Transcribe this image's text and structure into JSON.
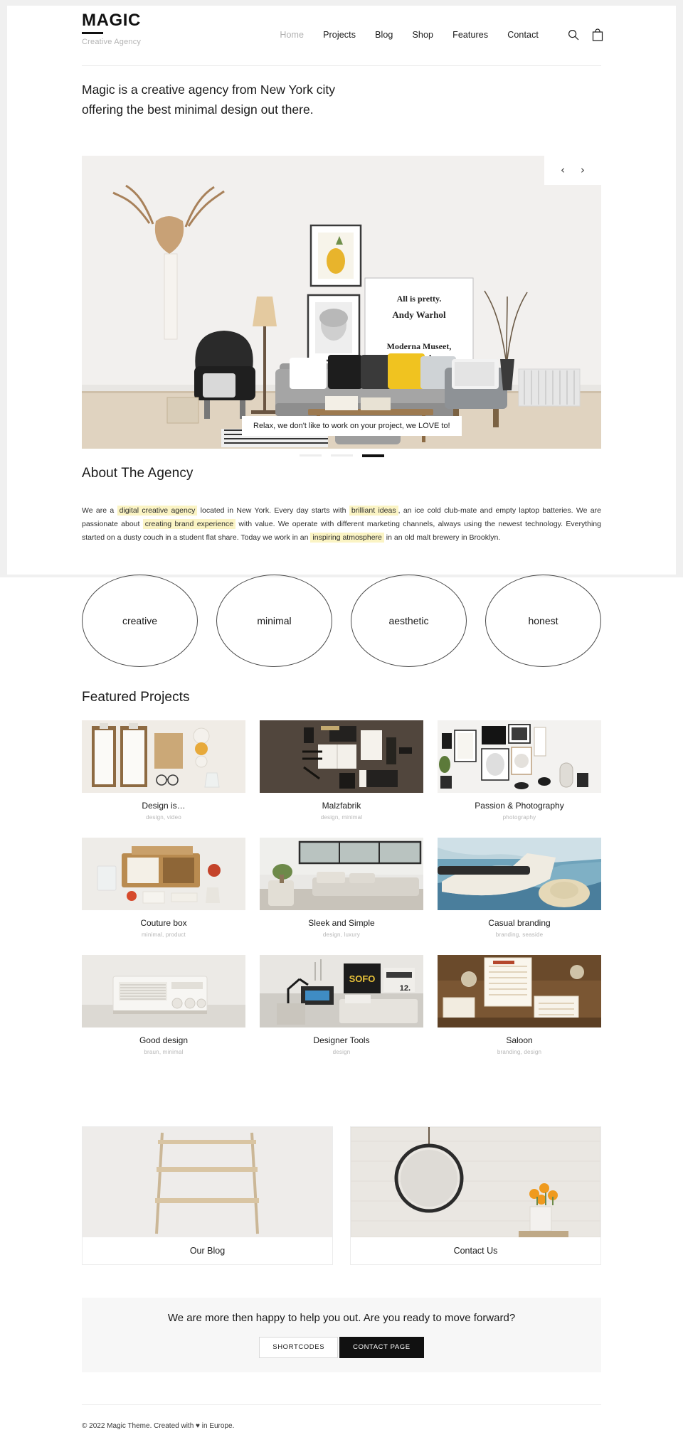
{
  "brand": {
    "name": "MAGIC",
    "tagline": "Creative Agency"
  },
  "nav": {
    "items": [
      {
        "label": "Home",
        "active": true
      },
      {
        "label": "Projects",
        "active": false
      },
      {
        "label": "Blog",
        "active": false
      },
      {
        "label": "Shop",
        "active": false
      },
      {
        "label": "Features",
        "active": false
      },
      {
        "label": "Contact",
        "active": false
      }
    ],
    "icons": [
      {
        "name": "search-icon"
      },
      {
        "name": "shopping-bag-icon"
      }
    ]
  },
  "hero": {
    "headline": "Magic is a creative agency from New York city offering the best minimal design out there."
  },
  "slider": {
    "prev_label": "‹",
    "next_label": "›",
    "caption": "Relax, we don't like to work on your project, we LOVE to!",
    "dots": [
      {
        "active": false
      },
      {
        "active": false
      },
      {
        "active": true
      }
    ]
  },
  "about": {
    "title": "About The Agency",
    "paragraph_parts": [
      {
        "text": "We are a ",
        "highlight": false
      },
      {
        "text": "digital creative agency",
        "highlight": true
      },
      {
        "text": " located in New York. Every day starts with ",
        "highlight": false
      },
      {
        "text": "brilliant ideas",
        "highlight": true
      },
      {
        "text": ", an ice cold club-mate and empty laptop batteries. We are passionate about ",
        "highlight": false
      },
      {
        "text": "creating brand experience",
        "highlight": true
      },
      {
        "text": " with value. We operate with different marketing channels, always using the newest technology. Everything started on a dusty couch in a student flat share. Today we work in an ",
        "highlight": false
      },
      {
        "text": "inspiring atmosphere",
        "highlight": true
      },
      {
        "text": " in an old malt brewery in Brooklyn.",
        "highlight": false
      }
    ]
  },
  "values": {
    "circles": [
      {
        "label": "creative"
      },
      {
        "label": "minimal"
      },
      {
        "label": "aesthetic"
      },
      {
        "label": "honest"
      }
    ]
  },
  "featured": {
    "title": "Featured Projects",
    "projects": [
      {
        "title": "Design is…",
        "categories": "design, video",
        "image": "flatlay-menus"
      },
      {
        "title": "Malzfabrik",
        "categories": "design, minimal",
        "image": "dark-stationery"
      },
      {
        "title": "Passion & Photography",
        "categories": "photography",
        "image": "gallery-wall"
      },
      {
        "title": "Couture box",
        "categories": "minimal, product",
        "image": "wooden-box"
      },
      {
        "title": "Sleek and Simple",
        "categories": "design, luxury",
        "image": "modern-lounge"
      },
      {
        "title": "Casual branding",
        "categories": "branding, seaside",
        "image": "sailing-boat"
      },
      {
        "title": "Good design",
        "categories": "braun, minimal",
        "image": "braun-radio"
      },
      {
        "title": "Designer Tools",
        "categories": "design",
        "image": "desk-workspace"
      },
      {
        "title": "Saloon",
        "categories": "branding, design",
        "image": "menu-cards"
      }
    ]
  },
  "promos": [
    {
      "label": "Our Blog",
      "image": "wall-shelf"
    },
    {
      "label": "Contact Us",
      "image": "round-mirror"
    }
  ],
  "cta": {
    "text": "We are more then happy to help you out. Are you ready to move forward?",
    "secondary_button": "SHORTCODES",
    "primary_button": "CONTACT PAGE"
  },
  "footer": {
    "copyright": "© 2022 Magic Theme. Created with ♥ in Europe."
  },
  "colors": {
    "ink": "#111111",
    "muted": "#b0b0b0",
    "highlight": "#fbf4c4",
    "panel": "#f7f7f7",
    "page_bg": "#f0f0f0"
  }
}
